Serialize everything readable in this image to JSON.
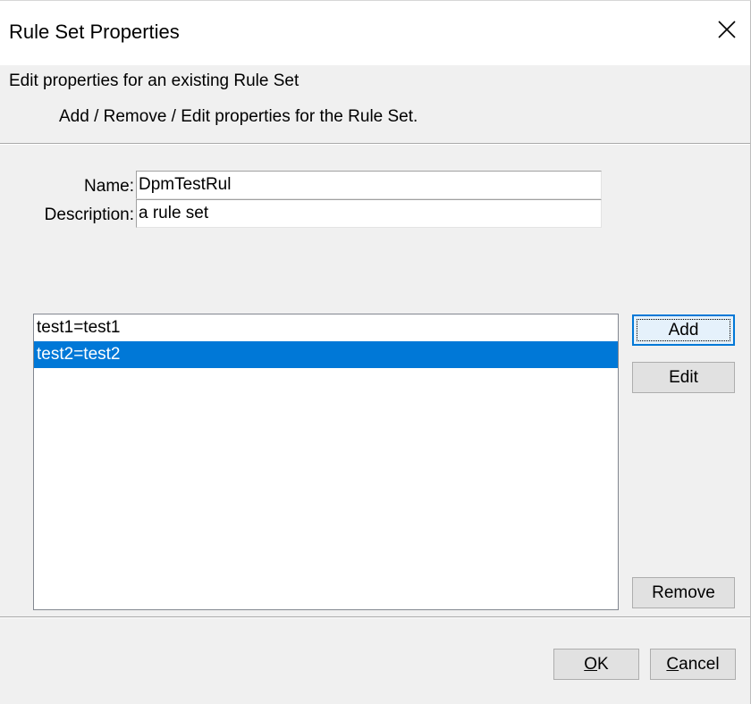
{
  "window": {
    "title": "Rule Set Properties",
    "close_glyph": "close-icon"
  },
  "header": {
    "title": "Edit properties for an existing Rule Set",
    "subtitle": "Add / Remove / Edit properties for the Rule Set."
  },
  "form": {
    "name_label": "Name:",
    "name_value": "DpmTestRul",
    "description_label": "Description:",
    "description_value": "a rule set"
  },
  "properties_list": {
    "items": [
      {
        "label": "test1=test1",
        "selected": false
      },
      {
        "label": "test2=test2",
        "selected": true
      }
    ],
    "selection_color": "#0078d7"
  },
  "buttons": {
    "add": "Add",
    "edit": "Edit",
    "remove": "Remove",
    "ok_mnemonic": "O",
    "ok_rest": "K",
    "cancel_mnemonic": "C",
    "cancel_rest": "ancel"
  },
  "colors": {
    "dialog_bg": "#f0f0f0",
    "accent": "#0078d7"
  }
}
